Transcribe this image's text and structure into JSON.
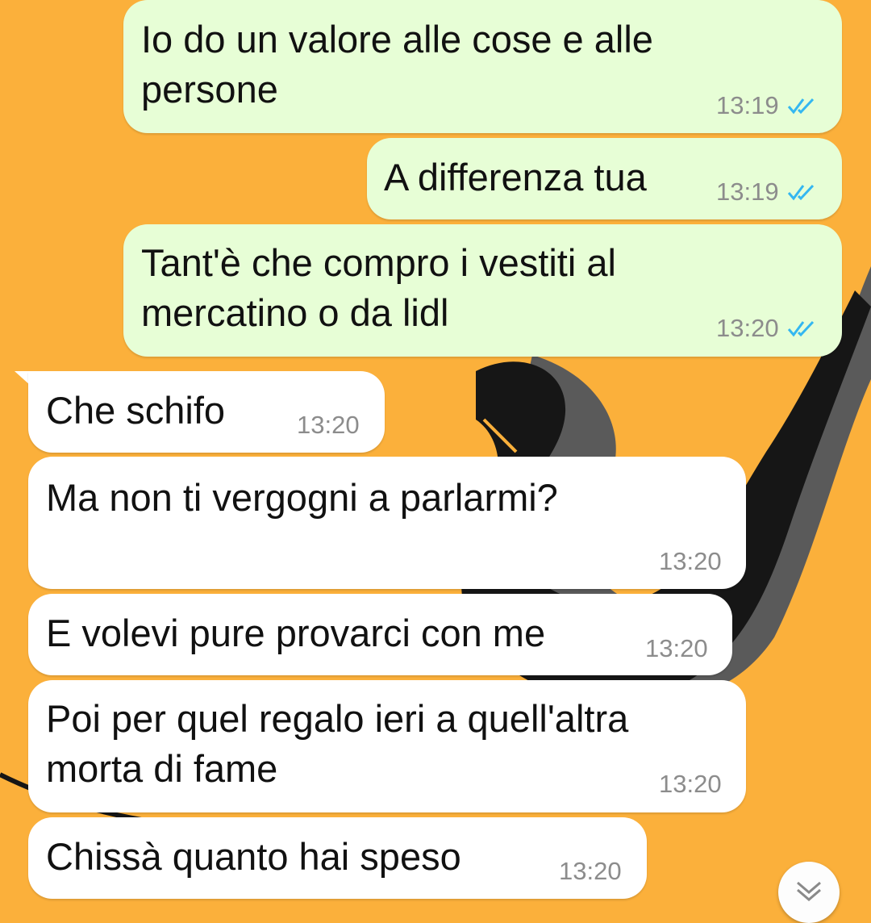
{
  "chat": {
    "messages": [
      {
        "direction": "outgoing",
        "text": "Io do un valore alle cose e alle\npersone",
        "time": "13:19",
        "read": true
      },
      {
        "direction": "outgoing",
        "text": "A differenza tua",
        "time": "13:19",
        "read": true
      },
      {
        "direction": "outgoing",
        "text": "Tant'è che compro i vestiti al\nmercatino o da lidl",
        "time": "13:20",
        "read": true
      },
      {
        "direction": "incoming",
        "text": "Che schifo",
        "time": "13:20"
      },
      {
        "direction": "incoming",
        "text": "Ma non ti vergogni a parlarmi?",
        "time": "13:20"
      },
      {
        "direction": "incoming",
        "text": "E volevi pure provarci con me",
        "time": "13:20"
      },
      {
        "direction": "incoming",
        "text": "Poi per quel regalo ieri a quell'altra\nmorta di fame",
        "time": "13:20"
      },
      {
        "direction": "incoming",
        "text": "Chissà quanto hai speso",
        "time": "13:20"
      }
    ],
    "read_tick_color": "#34b7f1",
    "scroll_icon": "double-chevron-down-icon"
  },
  "theme": {
    "wallpaper_color": "#fbb03b",
    "outgoing_bubble": "#e7fed6",
    "incoming_bubble": "#ffffff"
  }
}
